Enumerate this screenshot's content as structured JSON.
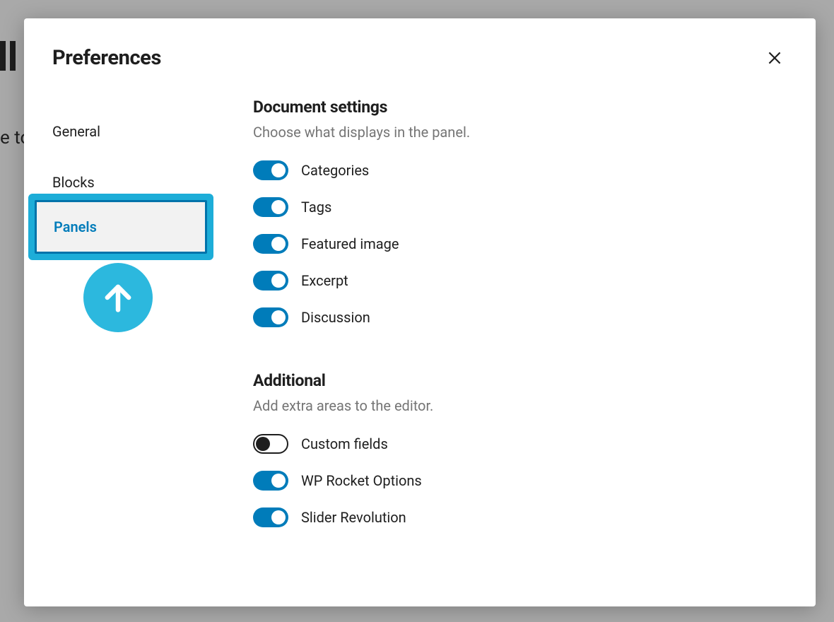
{
  "background_text": "e to",
  "modal": {
    "title": "Preferences"
  },
  "tabs": {
    "general": "General",
    "blocks": "Blocks",
    "panels": "Panels"
  },
  "sections": {
    "document": {
      "title": "Document settings",
      "desc": "Choose what displays in the panel.",
      "items": [
        {
          "label": "Categories",
          "on": true
        },
        {
          "label": "Tags",
          "on": true
        },
        {
          "label": "Featured image",
          "on": true
        },
        {
          "label": "Excerpt",
          "on": true
        },
        {
          "label": "Discussion",
          "on": true
        }
      ]
    },
    "additional": {
      "title": "Additional",
      "desc": "Add extra areas to the editor.",
      "items": [
        {
          "label": "Custom fields",
          "on": false
        },
        {
          "label": "WP Rocket Options",
          "on": true
        },
        {
          "label": "Slider Revolution",
          "on": true
        }
      ]
    }
  }
}
